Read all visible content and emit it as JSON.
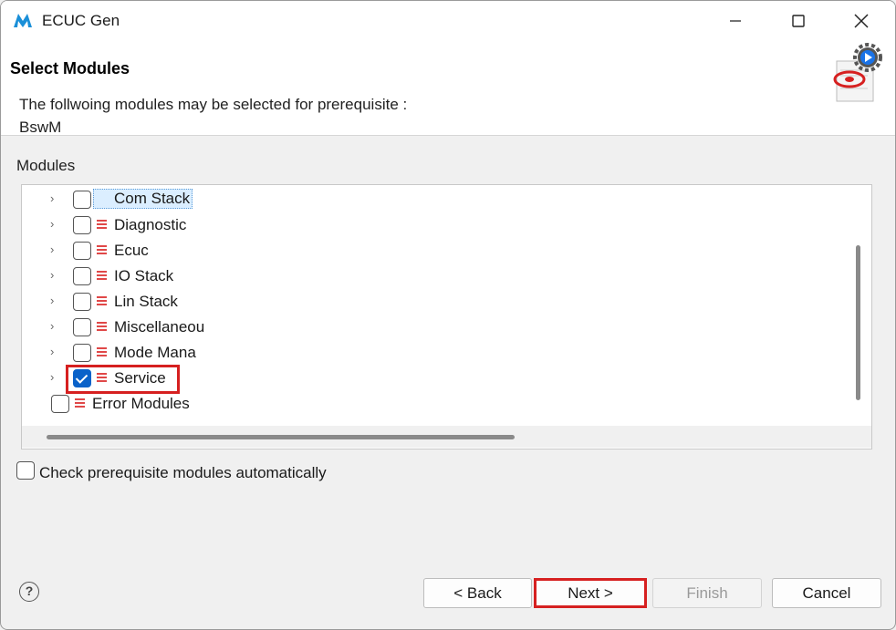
{
  "window": {
    "title": "ECUC Gen"
  },
  "header": {
    "title": "Select Modules",
    "description": "The follwoing modules may be selected for prerequisite :",
    "module": "BswM"
  },
  "modules": {
    "group_label": "Modules",
    "items": [
      {
        "label": "Com Stack",
        "checked": false,
        "expandable": true
      },
      {
        "label": "Diagnostic",
        "checked": false,
        "expandable": true
      },
      {
        "label": "Ecuc",
        "checked": false,
        "expandable": true
      },
      {
        "label": "IO Stack",
        "checked": false,
        "expandable": true
      },
      {
        "label": "Lin Stack",
        "checked": false,
        "expandable": true
      },
      {
        "label": "Miscellaneou",
        "checked": false,
        "expandable": true
      },
      {
        "label": "Mode Mana",
        "checked": false,
        "expandable": true
      },
      {
        "label": "Service",
        "checked": true,
        "expandable": true
      },
      {
        "label": "Error Modules",
        "checked": false,
        "expandable": false
      }
    ]
  },
  "options": {
    "auto_check_label": "Check prerequisite modules automatically",
    "auto_check": false
  },
  "footer": {
    "help": "?",
    "back_label": "< Back",
    "next_label": "Next >",
    "finish_label": "Finish",
    "cancel_label": "Cancel"
  },
  "colors": {
    "accent": "#0a62c9",
    "highlight": "#d62020",
    "module_icon": "#e04848"
  }
}
